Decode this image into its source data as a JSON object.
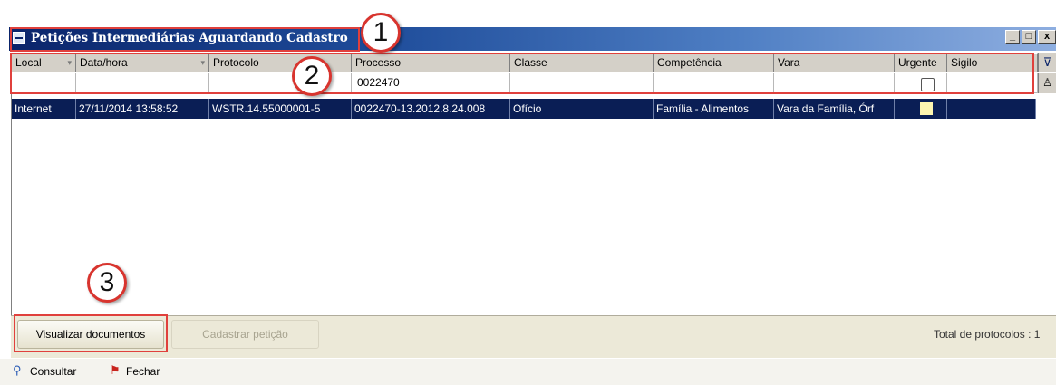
{
  "window": {
    "title": "Petições Intermediárias Aguardando Cadastro",
    "minimize_glyph": "_",
    "restore_glyph": "□",
    "close_glyph": "x"
  },
  "grid": {
    "columns": [
      "Local",
      "Data/hora",
      "Protocolo",
      "Processo",
      "Classe",
      "Competência",
      "Vara",
      "Urgente",
      "Sigilo"
    ],
    "filter": {
      "processo": "0022470"
    },
    "rows": [
      {
        "local": "Internet",
        "data_hora": "27/11/2014 13:58:52",
        "protocolo": "WSTR.14.55000001-5",
        "processo": "0022470-13.2012.8.24.008",
        "classe": "Ofício",
        "competencia": "Família - Alimentos",
        "vara": "Vara da Família, Órf",
        "urgente": true,
        "sigilo": ""
      }
    ],
    "selected_row_color": "#0a1e55"
  },
  "buttons": {
    "visualizar": "Visualizar documentos",
    "cadastrar": "Cadastrar petição"
  },
  "status": {
    "total_label": "Total de protocolos : 1"
  },
  "toolbar": {
    "consultar": "Consultar",
    "fechar": "Fechar"
  },
  "annotations": {
    "callout_1": "1",
    "callout_2": "2",
    "callout_3": "3",
    "color": "#e0403c"
  }
}
